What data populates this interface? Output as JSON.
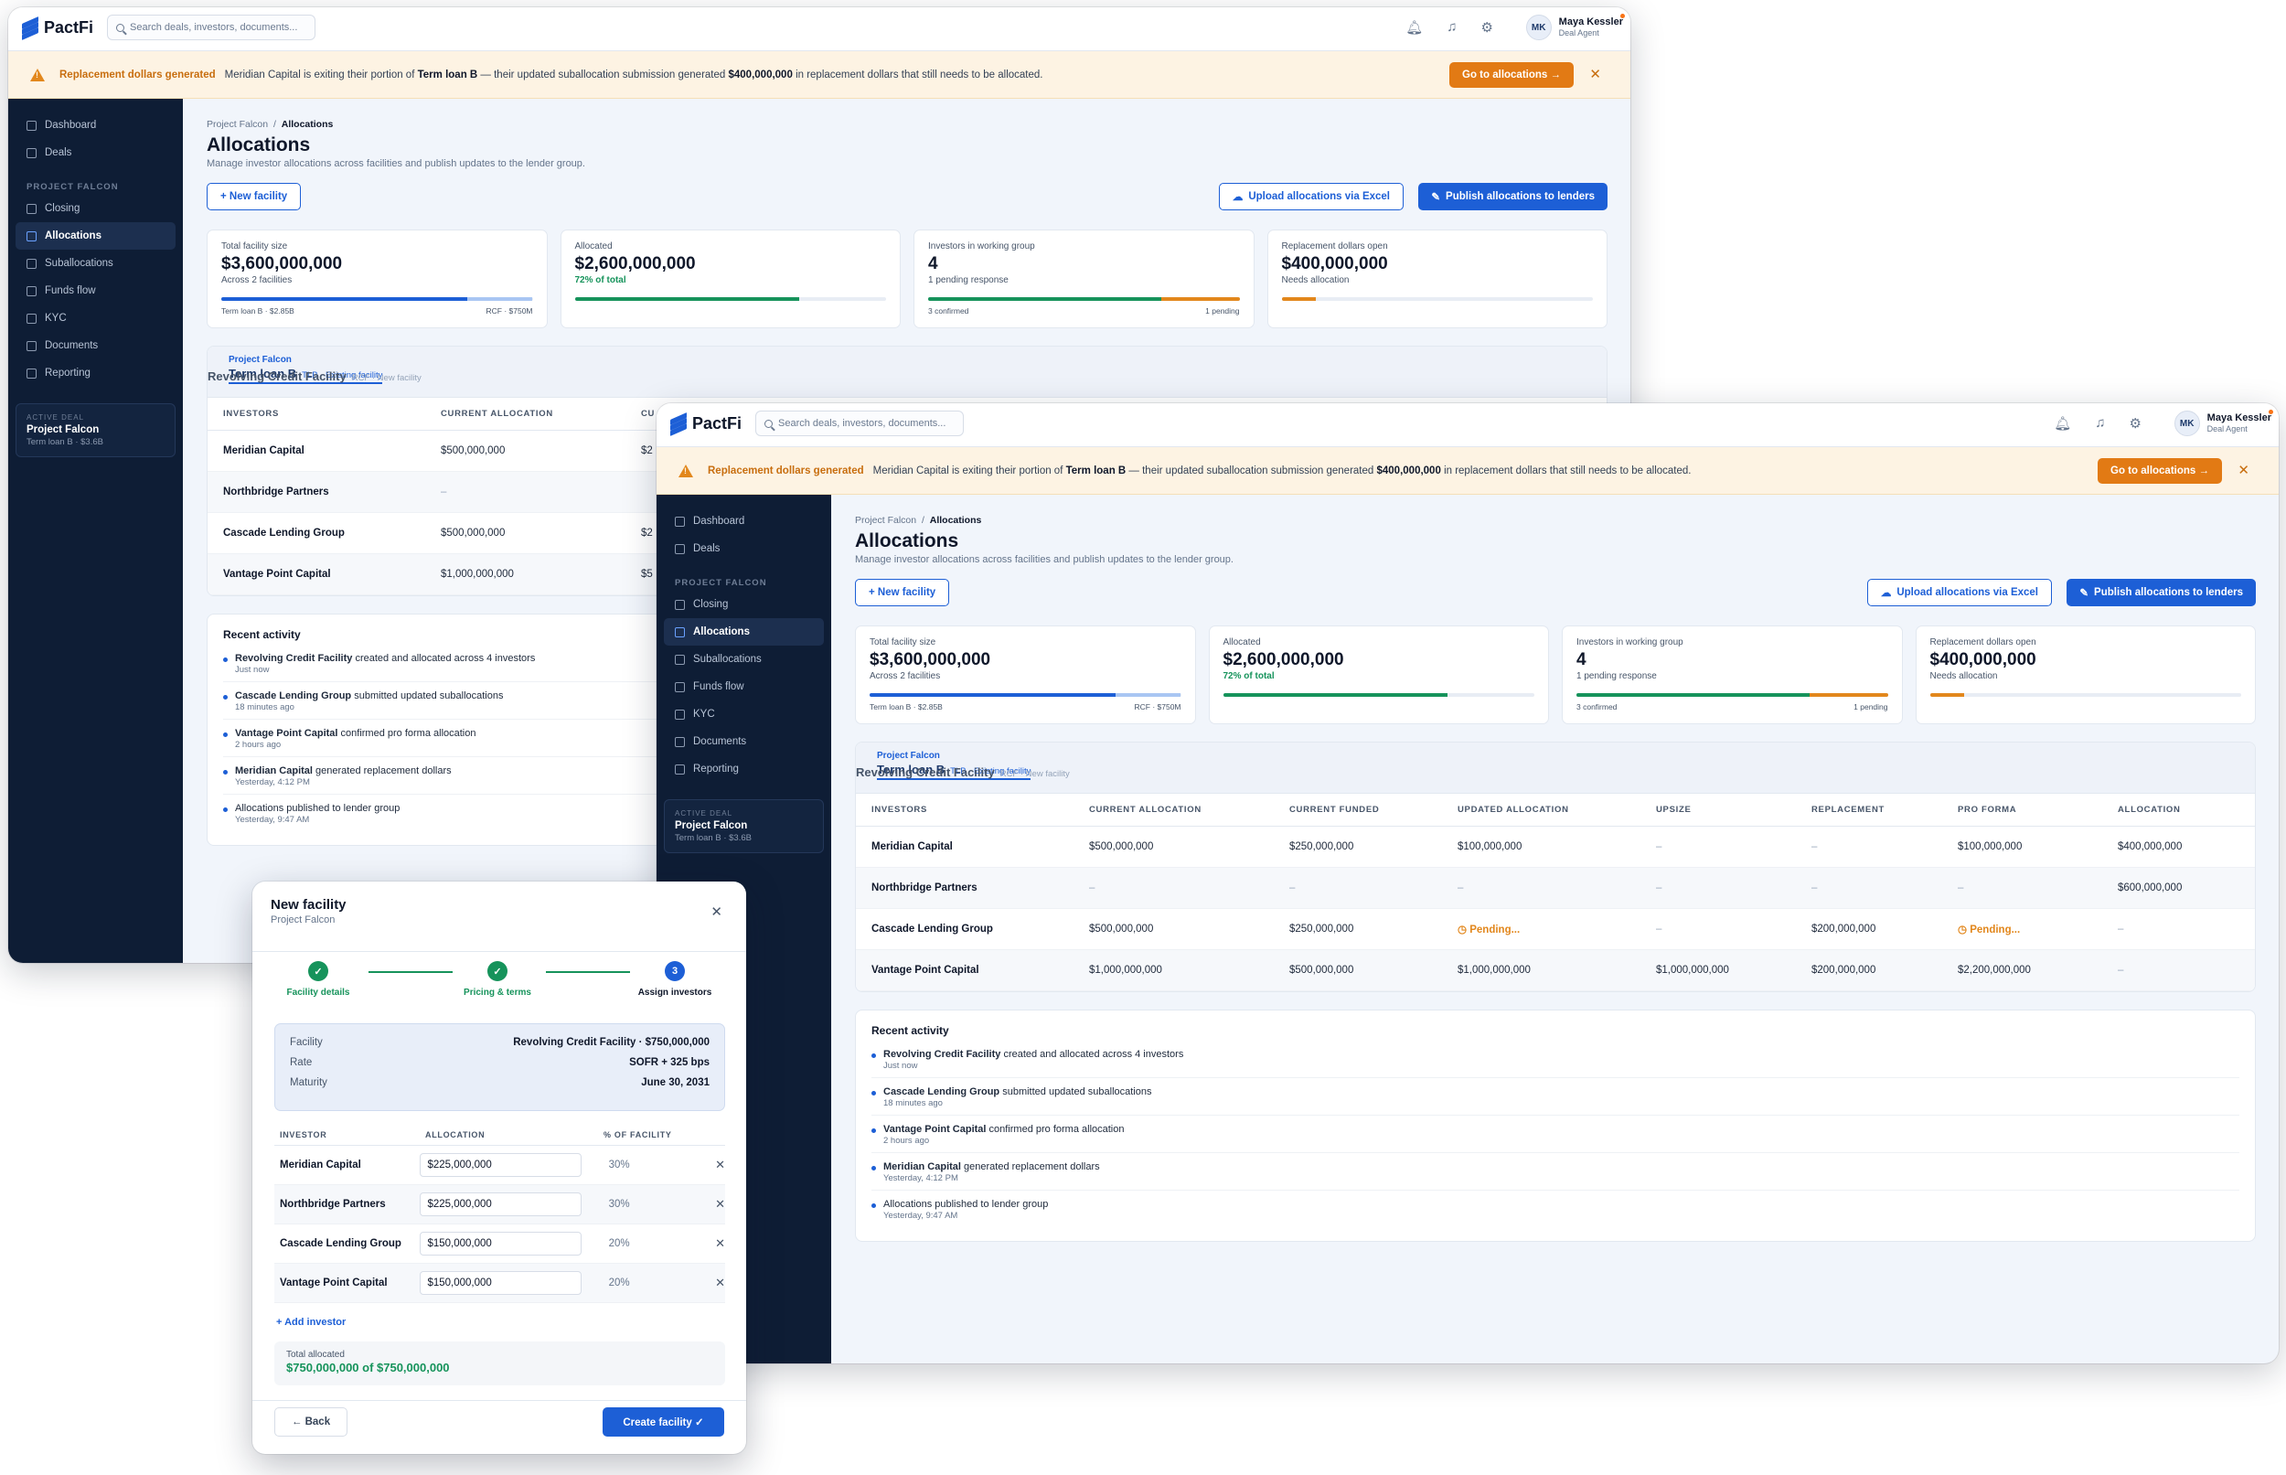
{
  "app": {
    "name": "PactFi",
    "search_placeholder": "Search deals, investors, documents...",
    "user_initials": "MK",
    "user_name": "Maya Kessler",
    "user_role": "Deal Agent"
  },
  "banner": {
    "title": "Replacement dollars generated",
    "msg_a": "Meridian Capital is exiting their portion of",
    "msg_b": "Term loan B",
    "msg_c": "— their updated suballocation submission generated",
    "msg_d": "$400,000,000",
    "msg_e": "in replacement dollars that still needs to be allocated.",
    "button": "Go to allocations →",
    "close": "✕"
  },
  "nav": {
    "items_top": [
      "Dashboard",
      "Deals"
    ],
    "section": "PROJECT FALCON",
    "items": [
      "Closing",
      "Allocations",
      "Suballocations",
      "Funds flow",
      "KYC",
      "Documents",
      "Reporting"
    ],
    "active": "Allocations",
    "deal_label": "ACTIVE DEAL",
    "deal_name": "Project Falcon",
    "deal_sub": "Term loan B · $3.6B"
  },
  "page": {
    "crumb_parent": "Project Falcon",
    "crumb_sep": "/",
    "crumb_current": "Allocations",
    "title": "Allocations",
    "subtitle": "Manage investor allocations across facilities and publish updates to the lender group.",
    "new_facility": "+  New facility",
    "upload": "Upload allocations via Excel",
    "publish": "Publish allocations to lenders"
  },
  "stats": [
    {
      "label": "Total facility size",
      "value": "$3,600,000,000",
      "sub": "Across 2 facilities",
      "bar": [
        {
          "pct": 0.79,
          "color": "#1d5fd6"
        },
        {
          "pct": 0.21,
          "color": "#a9c6f3"
        }
      ],
      "legend_left": "Term loan B · $2.85B",
      "legend_right": "RCF · $750M"
    },
    {
      "label": "Allocated",
      "value": "$2,600,000,000",
      "sub": "72% of total",
      "bar": [
        {
          "pct": 0.72,
          "color": "#16935b"
        }
      ]
    },
    {
      "label": "Investors in working group",
      "value": "4",
      "sub": "1 pending response",
      "bar": [
        {
          "pct": 0.75,
          "color": "#16935b"
        },
        {
          "pct": 0.25,
          "color": "#e2871c"
        }
      ],
      "legend_left": "3 confirmed",
      "legend_right": "1 pending"
    },
    {
      "label": "Replacement dollars open",
      "value": "$400,000,000",
      "sub": "Needs allocation",
      "bar": [
        {
          "pct": 0.11,
          "color": "#e2871c"
        }
      ]
    }
  ],
  "tabs": {
    "group": "Project Falcon",
    "tab1": "Term loan B",
    "tab1_tag": "TLB · Existing facility",
    "tab2": "Revolving Credit Facility",
    "tab2_tag": "RCF · New facility"
  },
  "table": {
    "headers": [
      "INVESTORS",
      "CURRENT ALLOCATION",
      "CURRENT FUNDED",
      "UPDATED ALLOCATION",
      "UPSIZE",
      "REPLACEMENT",
      "PRO FORMA",
      "ALLOCATION"
    ],
    "headers_a_last": "CU",
    "rows": [
      [
        "Meridian Capital",
        "$500,000,000",
        "$250,000,000",
        "$100,000,000",
        "–",
        "–",
        "$100,000,000",
        "$400,000,000"
      ],
      [
        "Northbridge Partners",
        "–",
        "–",
        "–",
        "–",
        "–",
        "–",
        "$600,000,000"
      ],
      [
        "Cascade Lending Group",
        "$500,000,000",
        "$250,000,000",
        "Pending...",
        "–",
        "$200,000,000",
        "Pending...",
        "–"
      ],
      [
        "Vantage Point Capital",
        "$1,000,000,000",
        "$500,000,000",
        "$1,000,000,000",
        "$1,000,000,000",
        "$200,000,000",
        "$2,200,000,000",
        "–"
      ]
    ],
    "rows_a_partial": [
      "$2",
      "",
      "$2",
      "$5"
    ]
  },
  "activity": {
    "title": "Recent activity",
    "items": [
      {
        "b": "Revolving Credit Facility",
        "t": "created and allocated across 4 investors",
        "time": "Just now"
      },
      {
        "b": "Cascade Lending Group",
        "t": "submitted updated suballocations",
        "time": "18 minutes ago"
      },
      {
        "b": "Vantage Point Capital",
        "t": "confirmed pro forma allocation",
        "time": "2 hours ago"
      },
      {
        "b": "Meridian Capital",
        "t": "generated replacement dollars",
        "time": "Yesterday, 4:12 PM"
      },
      {
        "b": "",
        "t": "Allocations published to lender group",
        "time": "Yesterday, 9:47 AM"
      }
    ]
  },
  "modal": {
    "title": "New facility",
    "subtitle": "Project Falcon",
    "close": "✕",
    "steps": [
      {
        "n": "✓",
        "label": "Facility details"
      },
      {
        "n": "✓",
        "label": "Pricing & terms"
      },
      {
        "n": "3",
        "label": "Assign investors"
      }
    ],
    "summary": [
      {
        "k": "Facility",
        "v": "Revolving Credit Facility · $750,000,000"
      },
      {
        "k": "Rate",
        "v": "SOFR + 325 bps"
      },
      {
        "k": "Maturity",
        "v": "June 30, 2031"
      }
    ],
    "headers": [
      "INVESTOR",
      "ALLOCATION",
      "% OF FACILITY"
    ],
    "rows": [
      {
        "name": "Meridian Capital",
        "amount": "$225,000,000",
        "pct": "30%"
      },
      {
        "name": "Northbridge Partners",
        "amount": "$225,000,000",
        "pct": "30%"
      },
      {
        "name": "Cascade Lending Group",
        "amount": "$150,000,000",
        "pct": "20%"
      },
      {
        "name": "Vantage Point Capital",
        "amount": "$150,000,000",
        "pct": "20%"
      }
    ],
    "remove": "✕",
    "add": "+  Add investor",
    "total_label": "Total allocated",
    "total_value": "$750,000,000 of $750,000,000",
    "back": "←  Back",
    "create": "Create facility ✓"
  },
  "colors": {
    "brand": "#1d5fd6",
    "sidebar": "#0e1d35",
    "warning": "#e2871c",
    "success": "#16935b"
  }
}
